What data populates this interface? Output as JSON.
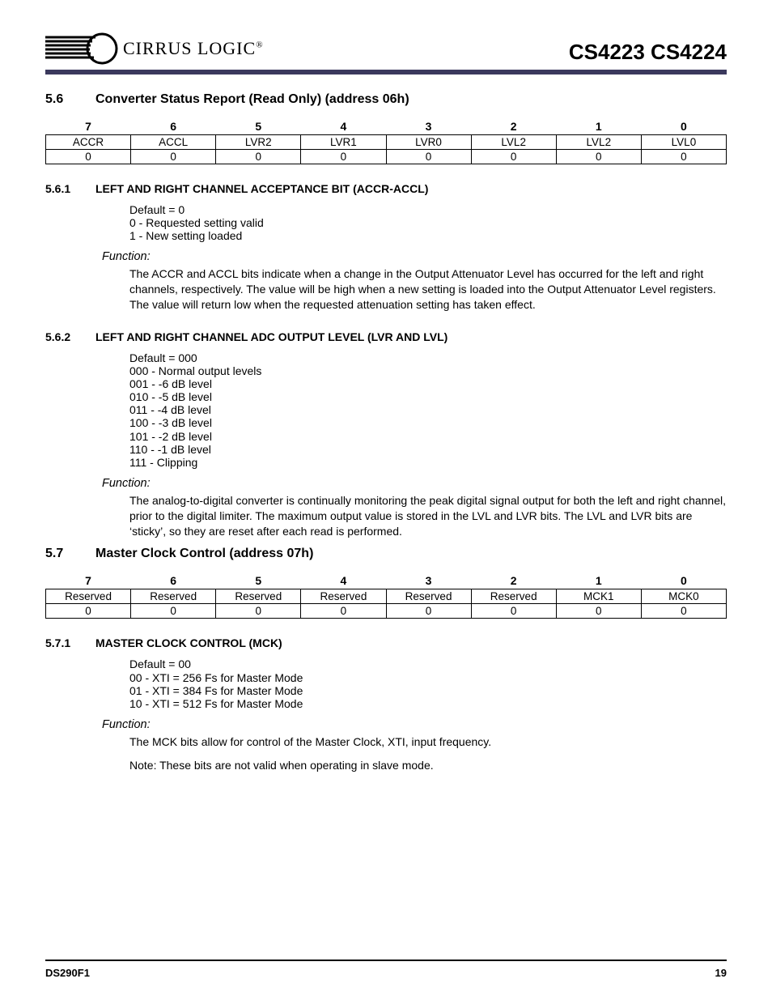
{
  "header": {
    "logo_text": "CIRRUS LOGIC",
    "product_codes": "CS4223 CS4224"
  },
  "sections": {
    "s56": {
      "num": "5.6",
      "title": "Converter Status Report (Read Only) (address 06h)",
      "bits_header": [
        "7",
        "6",
        "5",
        "4",
        "3",
        "2",
        "1",
        "0"
      ],
      "bits_names": [
        "ACCR",
        "ACCL",
        "LVR2",
        "LVR1",
        "LVR0",
        "LVL2",
        "LVL2",
        "LVL0"
      ],
      "bits_values": [
        "0",
        "0",
        "0",
        "0",
        "0",
        "0",
        "0",
        "0"
      ],
      "sub561": {
        "num": "5.6.1",
        "title": "LEFT AND RIGHT CHANNEL ACCEPTANCE BIT (ACCR-ACCL)",
        "defaults": [
          "Default = 0",
          "0 - Requested setting valid",
          "1 - New setting loaded"
        ],
        "func_label": "Function:",
        "func_body": "The ACCR and ACCL bits indicate when a change in the Output Attenuator Level has occurred for the left and right channels, respectively.  The value will be high when a new setting is loaded into the Output Attenuator Level registers.  The value will return low when the requested attenuation setting has taken effect."
      },
      "sub562": {
        "num": "5.6.2",
        "title": "LEFT AND RIGHT CHANNEL ADC OUTPUT LEVEL (LVR AND LVL)",
        "defaults": [
          "Default = 000",
          "000 - Normal output levels",
          "001 -  -6 dB level",
          "010 -  -5 dB level",
          "011 -  -4 dB level",
          "100 -  -3 dB level",
          "101 -  -2 dB level",
          "110 -  -1 dB level",
          "111 -  Clipping"
        ],
        "func_label": "Function:",
        "func_body": "The analog-to-digital converter is continually monitoring the peak digital signal output for both the left and right channel, prior to the digital limiter.  The maximum output value is stored in the LVL and LVR bits.  The LVL and LVR bits are ‘sticky’, so they are reset after each read is performed."
      }
    },
    "s57": {
      "num": "5.7",
      "title": "Master Clock Control (address 07h)",
      "bits_header": [
        "7",
        "6",
        "5",
        "4",
        "3",
        "2",
        "1",
        "0"
      ],
      "bits_names": [
        "Reserved",
        "Reserved",
        "Reserved",
        "Reserved",
        "Reserved",
        "Reserved",
        "MCK1",
        "MCK0"
      ],
      "bits_values": [
        "0",
        "0",
        "0",
        "0",
        "0",
        "0",
        "0",
        "0"
      ],
      "sub571": {
        "num": "5.7.1",
        "title": "MASTER CLOCK CONTROL (MCK)",
        "defaults": [
          "Default = 00",
          "00 - XTI = 256 Fs for Master Mode",
          "01 - XTI = 384 Fs for Master Mode",
          "10 - XTI = 512 Fs for Master Mode"
        ],
        "func_label": "Function:",
        "func_body": "The MCK bits allow for control of the Master Clock, XTI, input frequency.",
        "func_note": "Note: These bits are not valid when operating in slave mode."
      }
    }
  },
  "footer": {
    "left": "DS290F1",
    "right": "19"
  }
}
